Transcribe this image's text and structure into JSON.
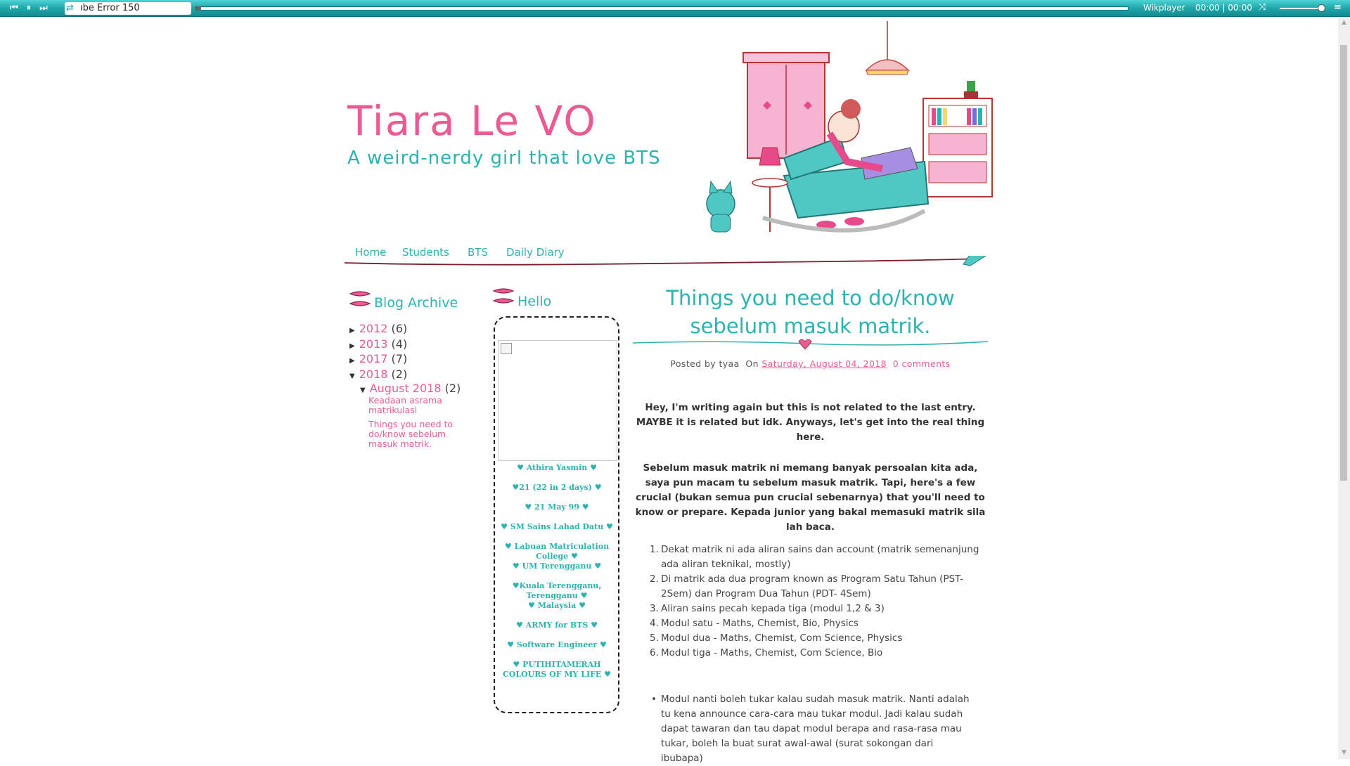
{
  "player": {
    "title": "ıbe Error 150",
    "name": "Wikplayer",
    "time": "00:00 | 00:00",
    "icons": [
      "prev-icon",
      "pause-icon",
      "next-icon",
      "repeat-icon",
      "shuffle-icon",
      "menu-icon"
    ]
  },
  "header": {
    "title": "Tiara Le VO",
    "description": "A weird-nerdy girl that love BTS"
  },
  "nav": {
    "items": [
      "Home",
      "Students",
      "BTS",
      "Daily Diary"
    ]
  },
  "archive": {
    "title": "Blog Archive",
    "years": [
      {
        "year": "2012",
        "count": "(6)",
        "expanded": false
      },
      {
        "year": "2013",
        "count": "(4)",
        "expanded": false
      },
      {
        "year": "2017",
        "count": "(7)",
        "expanded": false
      },
      {
        "year": "2018",
        "count": "(2)",
        "expanded": true
      }
    ],
    "month": {
      "label": "August 2018",
      "count": "(2)"
    },
    "posts": [
      "Keadaan asrama matrikulasi",
      "Things you need to do/know sebelum masuk matrik."
    ]
  },
  "hello": {
    "title": "Hello",
    "items": [
      "♥ Athira Yasmin ♥",
      "♥21 (22 in 2 days) ♥",
      "♥ 21 May 99 ♥",
      "♥ SM Sains Lahad Datu ♥",
      "♥ Labuan Matriculation College ♥",
      "♥ UM Terengganu ♥",
      "♥Kuala Terengganu, Terengganu ♥",
      "♥ Malaysia ♥",
      "♥ ARMY for BTS ♥",
      "♥ Software Engineer ♥",
      "♥ PUTIHITAMERAH COLOURS OF MY LIFE ♥"
    ]
  },
  "post": {
    "title": "Things you need to do/know sebelum masuk matrik.",
    "posted_by": "Posted by tyaa",
    "on": "On",
    "date": "Saturday, August 04, 2018",
    "comments": "0 comments",
    "para1": "Hey, I'm writing again but this is not related to the last entry. MAYBE it is related but idk. Anyways, let's get into the real thing here.",
    "para2": "Sebelum masuk matrik ni memang banyak persoalan kita ada, saya pun macam tu sebelum masuk matrik. Tapi, here's a few crucial (bukan semua pun crucial sebenarnya) that you'll need to know or prepare. Kepada junior yang bakal memasuki matrik sila lah baca.",
    "list": [
      "Dekat matrik ni ada aliran sains dan account (matrik semenanjung ada aliran teknikal, mostly)",
      "Di matrik ada dua program known as Program Satu Tahun (PST- 2Sem) dan Program Dua Tahun (PDT- 4Sem)",
      "Aliran sains pecah kepada tiga (modul 1,2 & 3)",
      "Modul satu - Maths, Chemist, Bio, Physics",
      "Modul dua - Maths, Chemist, Com Science, Physics",
      "Modul tiga - Maths, Chemist, Com Science, Bio"
    ],
    "bullet": "Modul nanti boleh tukar kalau sudah masuk matrik. Nanti adalah tu kena announce cara-cara mau tukar modul. Jadi kalau sudah dapat tawaran dan tau dapat modul berapa and rasa-rasa mau tukar, boleh la buat surat awal-awal (surat sokongan dari ibubapa)"
  },
  "colors": {
    "pink": "#ec5a93",
    "teal": "#2bb3b0",
    "player": "#1fa7ab"
  }
}
